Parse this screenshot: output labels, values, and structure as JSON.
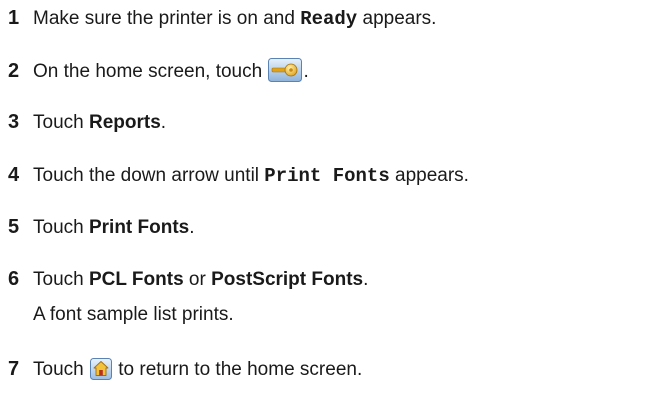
{
  "steps": [
    {
      "number": "1",
      "parts": [
        {
          "text": "Make sure the printer is on and "
        },
        {
          "text": "Ready",
          "style": "mono"
        },
        {
          "text": " appears."
        }
      ]
    },
    {
      "number": "2",
      "parts": [
        {
          "text": "On the home screen, touch "
        },
        {
          "icon": "settings-key-icon"
        },
        {
          "text": "."
        }
      ]
    },
    {
      "number": "3",
      "parts": [
        {
          "text": "Touch "
        },
        {
          "text": "Reports",
          "style": "bold"
        },
        {
          "text": "."
        }
      ]
    },
    {
      "number": "4",
      "parts": [
        {
          "text": "Touch the down arrow until "
        },
        {
          "text": "Print Fonts",
          "style": "mono"
        },
        {
          "text": " appears."
        }
      ]
    },
    {
      "number": "5",
      "parts": [
        {
          "text": "Touch "
        },
        {
          "text": "Print Fonts",
          "style": "bold"
        },
        {
          "text": "."
        }
      ]
    },
    {
      "number": "6",
      "parts": [
        {
          "text": "Touch "
        },
        {
          "text": "PCL Fonts",
          "style": "bold"
        },
        {
          "text": " or "
        },
        {
          "text": "PostScript Fonts",
          "style": "bold"
        },
        {
          "text": "."
        }
      ],
      "note": "A font sample list prints."
    },
    {
      "number": "7",
      "parts": [
        {
          "text": "Touch "
        },
        {
          "icon": "home-icon"
        },
        {
          "text": " to return to the home screen."
        }
      ]
    }
  ]
}
